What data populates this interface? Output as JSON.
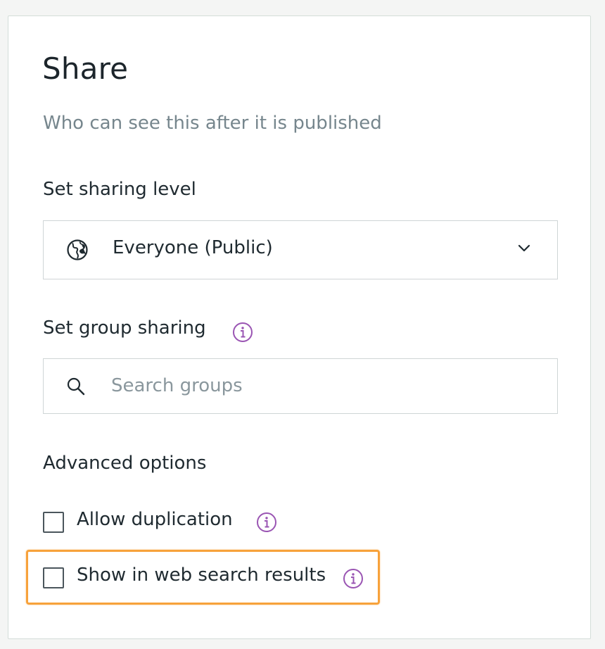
{
  "panel": {
    "title": "Share",
    "subtitle": "Who can see this after it is published"
  },
  "sharing_level": {
    "label": "Set sharing level",
    "selected": "Everyone (Public)",
    "icon": "globe-icon",
    "dropdown_icon": "chevron-down-icon"
  },
  "group_sharing": {
    "label": "Set group sharing",
    "info_icon": "info-icon",
    "search_placeholder": "Search groups",
    "search_value": "",
    "search_icon": "search-icon"
  },
  "advanced": {
    "label": "Advanced options",
    "options": [
      {
        "label": "Allow duplication",
        "checked": false,
        "info_icon": "info-icon"
      },
      {
        "label": "Show in web search results",
        "checked": false,
        "info_icon": "info-icon",
        "highlighted": true
      }
    ]
  },
  "colors": {
    "accent_info": "#9a55b3",
    "highlight": "#f7a23b",
    "subtitle_text": "#76868d",
    "border": "#cfd5d6"
  }
}
